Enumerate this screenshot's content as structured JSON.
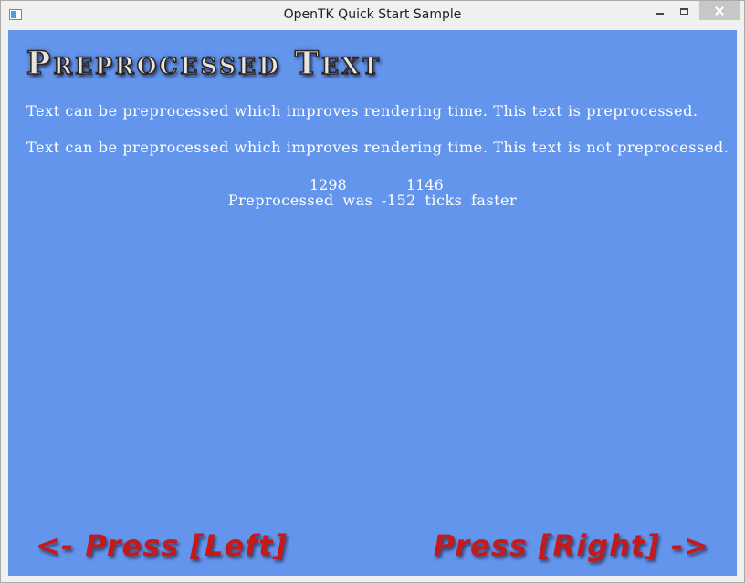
{
  "window": {
    "title": "OpenTK Quick Start Sample"
  },
  "canvas": {
    "background": "#6495ed",
    "heading": "Preprocessed Text",
    "line_preprocessed": "Text can be preprocessed which improves rendering time. This text is preprocessed.",
    "line_not_preprocessed": "Text can be preprocessed which improves rendering time. This text is not preprocessed.",
    "ticks_first": "1298",
    "ticks_second": "1146",
    "summary": "Preprocessed was -152 ticks faster",
    "nav_left": "<- Press [Left]",
    "nav_right": "Press [Right] ->"
  },
  "colors": {
    "nav_text": "#c41a1a",
    "body_text": "#ffffff"
  },
  "icons": {
    "app": "app-window-icon",
    "minimize": "minimize-icon",
    "maximize": "maximize-icon",
    "close": "close-icon"
  }
}
